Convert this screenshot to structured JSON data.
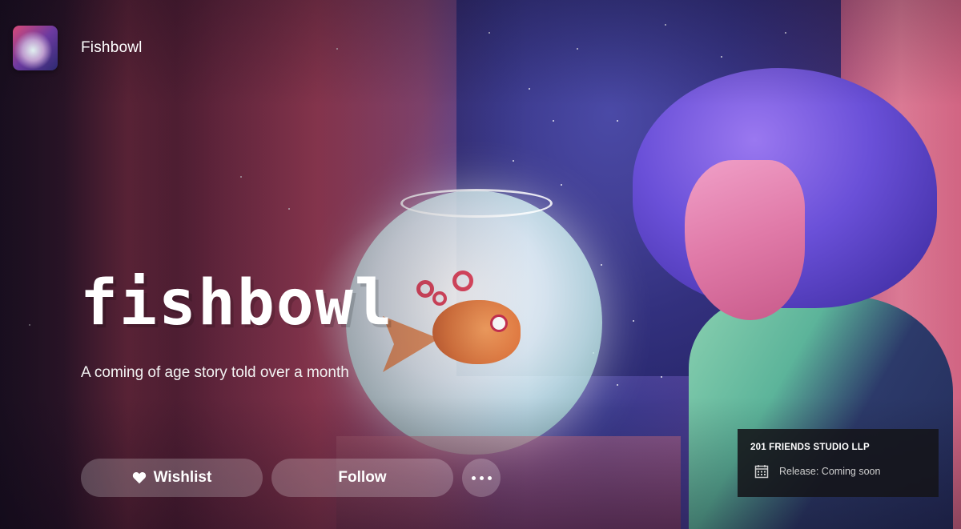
{
  "header": {
    "app_title": "Fishbowl",
    "thumbnail_icon": "game-thumbnail"
  },
  "hero": {
    "logo_text": "fishbowl",
    "tagline": "A coming of age story told over a month"
  },
  "actions": {
    "wishlist_label": "Wishlist",
    "wishlist_icon": "heart-icon",
    "follow_label": "Follow",
    "more_icon": "more-options-icon"
  },
  "info": {
    "publisher": "201 FRIENDS STUDIO LLP",
    "release_icon": "calendar-icon",
    "release_text": "Release: Coming soon"
  },
  "colors": {
    "button_bg": "rgba(255,255,255,0.22)",
    "panel_bg": "#141419",
    "text_primary": "#ffffff",
    "text_secondary": "#cfcfcf"
  }
}
